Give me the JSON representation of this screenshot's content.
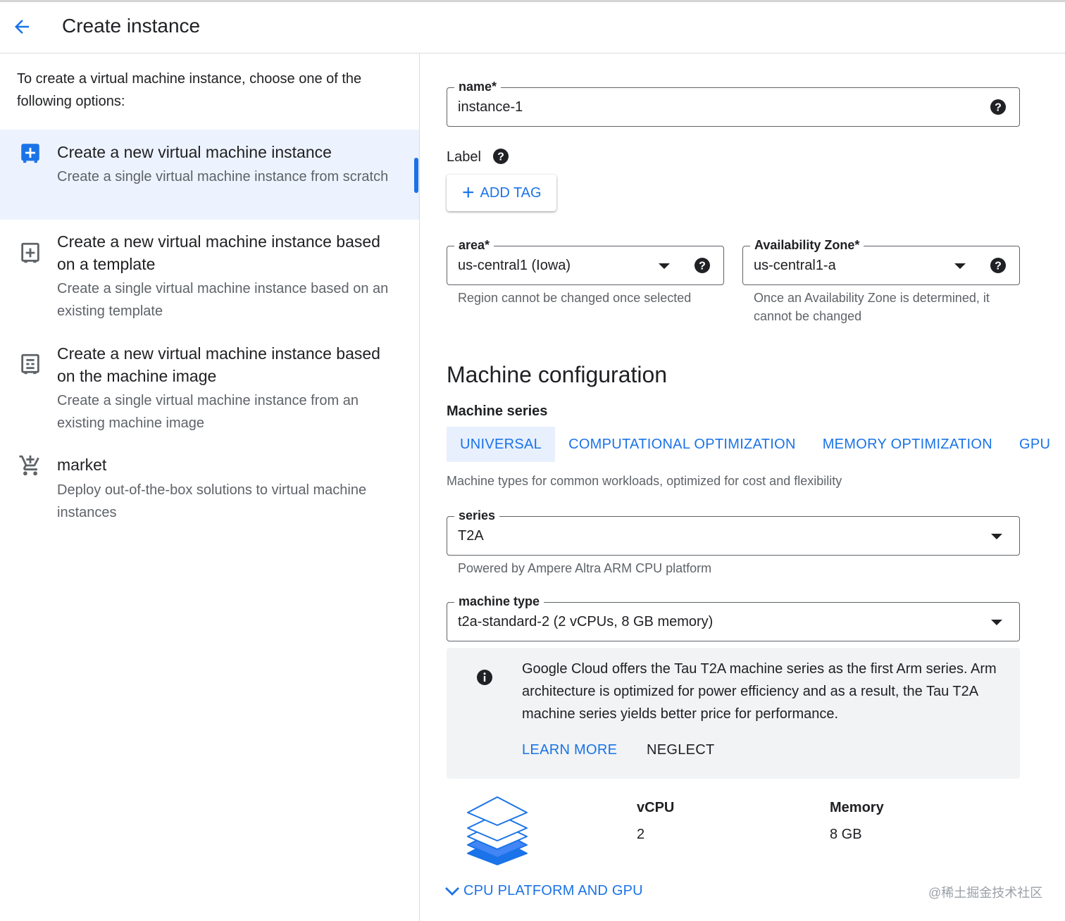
{
  "header": {
    "title": "Create instance"
  },
  "left": {
    "intro": "To create a virtual machine instance, choose one of the following options:",
    "options": [
      {
        "title": "Create a new virtual machine instance",
        "desc": "Create a single virtual machine instance from scratch",
        "icon": "add-box-icon",
        "selected": true
      },
      {
        "title": "Create a new virtual machine instance based on a template",
        "desc": "Create a single virtual machine instance based on an existing template",
        "icon": "template-icon",
        "selected": false
      },
      {
        "title": "Create a new virtual machine instance based on the machine image",
        "desc": "Create a single virtual machine instance from an existing machine image",
        "icon": "machine-image-icon",
        "selected": false
      },
      {
        "title": "market",
        "desc": "Deploy out-of-the-box solutions to virtual machine instances",
        "icon": "cart-icon",
        "selected": false
      }
    ]
  },
  "form": {
    "name": {
      "label": "name*",
      "value": "instance-1"
    },
    "label_section": {
      "title": "Label",
      "add_tag": "ADD TAG"
    },
    "area": {
      "label": "area*",
      "value": "us-central1 (Iowa)",
      "hint": "Region cannot be changed once selected"
    },
    "zone": {
      "label": "Availability Zone*",
      "value": "us-central1-a",
      "hint": "Once an Availability Zone is determined, it cannot be changed"
    }
  },
  "machine": {
    "title": "Machine configuration",
    "series_title": "Machine series",
    "tabs": [
      "UNIVERSAL",
      "COMPUTATIONAL OPTIMIZATION",
      "MEMORY OPTIMIZATION",
      "GPU"
    ],
    "active_tab": "UNIVERSAL",
    "tab_desc": "Machine types for common workloads, optimized for cost and flexibility",
    "series": {
      "label": "series",
      "value": "T2A",
      "hint": "Powered by Ampere Altra ARM CPU platform"
    },
    "machine_type": {
      "label": "machine type",
      "value": "t2a-standard-2 (2 vCPUs, 8 GB memory)"
    },
    "info": {
      "text": "Google Cloud offers the Tau T2A machine series as the first Arm series. Arm architecture is optimized for power efficiency and as a result, the Tau T2A machine series yields better price for performance.",
      "learn_more": "LEARN MORE",
      "neglect": "NEGLECT"
    },
    "specs": {
      "vcpu_label": "vCPU",
      "vcpu_value": "2",
      "memory_label": "Memory",
      "memory_value": "8 GB"
    },
    "expander": "CPU PLATFORM AND GPU"
  },
  "watermark": "@稀土掘金技术社区",
  "colors": {
    "accent": "#1a73e8",
    "selected_bg": "#e8f0fe",
    "info_bg": "#f1f3f4"
  }
}
